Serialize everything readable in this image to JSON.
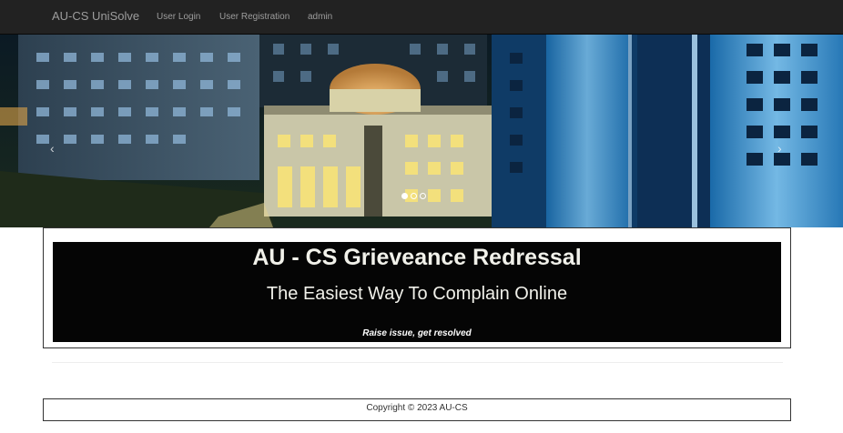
{
  "navbar": {
    "brand": "AU-CS UniSolve",
    "links": [
      "User Login",
      "User Registration",
      "admin"
    ]
  },
  "carousel": {
    "prev_icon": "chevron-left-icon",
    "next_icon": "chevron-right-icon",
    "prev_glyph": "‹",
    "next_glyph": "›",
    "slide_count": 3,
    "active_slide": 1
  },
  "hero": {
    "title": "AU - CS Grieveance Redressal",
    "subtitle": "The Easiest Way To Complain Online",
    "tagline": "Raise issue, get resolved"
  },
  "footer": {
    "copyright": "Copyright © 2023 AU-CS"
  },
  "colors": {
    "navbar_bg": "#222222",
    "nav_text": "#9d9d9d",
    "hero_bg": "#050505",
    "hero_text": "#f1f1ea",
    "border": "#333333"
  }
}
